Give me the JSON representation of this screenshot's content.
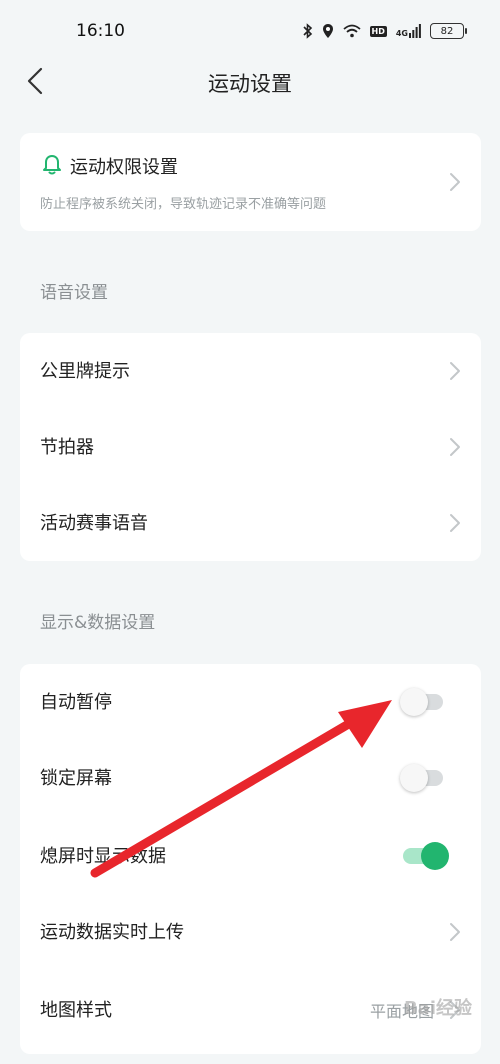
{
  "status_bar": {
    "time": "16:10",
    "network": "4G",
    "hd": "HD",
    "battery": "82"
  },
  "nav": {
    "title": "运动设置"
  },
  "permission": {
    "title": "运动权限设置",
    "description": "防止程序被系统关闭，导致轨迹记录不准确等问题"
  },
  "voice_section": {
    "label": "语音设置",
    "items": [
      {
        "label": "公里牌提示"
      },
      {
        "label": "节拍器"
      },
      {
        "label": "活动赛事语音"
      }
    ]
  },
  "display_section": {
    "label": "显示&数据设置",
    "items": [
      {
        "label": "自动暂停",
        "toggle": false
      },
      {
        "label": "锁定屏幕",
        "toggle": false
      },
      {
        "label": "熄屏时显示数据",
        "toggle": true
      },
      {
        "label": "运动数据实时上传"
      },
      {
        "label": "地图样式",
        "value": "平面地图"
      }
    ]
  },
  "watermark": "Bai经验",
  "colors": {
    "accent_green": "#22b56f",
    "annotation_arrow": "#e8262c",
    "background": "#f3f6f7"
  }
}
